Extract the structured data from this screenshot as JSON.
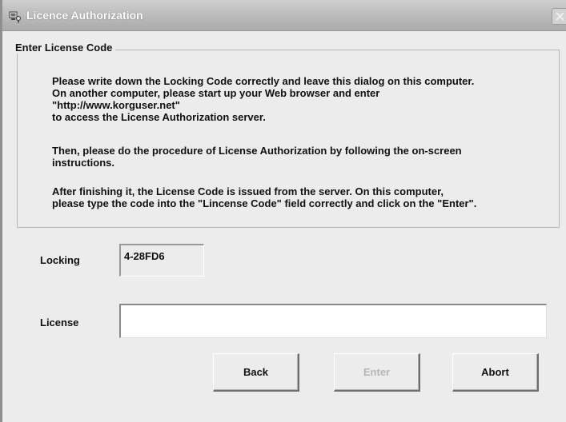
{
  "window": {
    "title": "Licence Authorization"
  },
  "group": {
    "title": "Enter License Code",
    "paragraph1": [
      "Please write down the Locking Code correctly and leave this dialog on this computer.",
      "On another computer, please start up your Web browser and enter",
      "\"http://www.korguser.net\"",
      "to access the License Authorization server."
    ],
    "paragraph2": [
      "Then, please do the procedure of License Authorization by following the on-screen",
      "instructions."
    ],
    "paragraph3": [
      "After finishing it, the License Code is issued from the server. On this computer,",
      "please type the code into the \"Lincense Code\" field correctly and click on the \"Enter\"."
    ]
  },
  "fields": {
    "locking_label": "Locking",
    "locking_value": "4-28FD6",
    "license_label": "License",
    "license_value": ""
  },
  "buttons": {
    "back": "Back",
    "enter": "Enter",
    "enter_enabled": false,
    "abort": "Abort"
  },
  "colors": {
    "dialog_background": "#ececec",
    "disabled_text": "#b6b6b6"
  },
  "icons": {
    "app": "computer-key-icon",
    "close": "close-icon"
  }
}
